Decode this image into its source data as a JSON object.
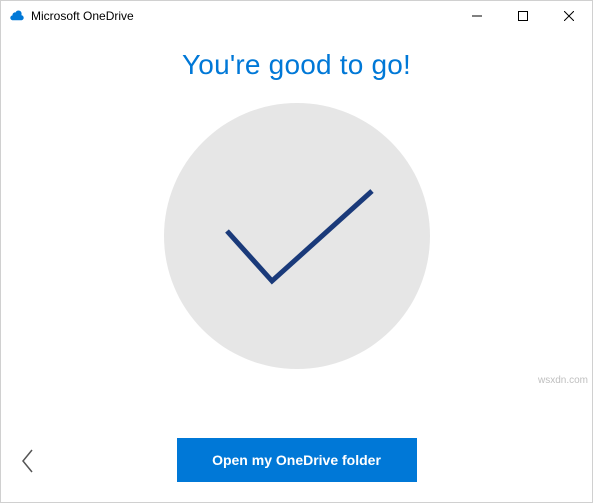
{
  "window": {
    "title": "Microsoft OneDrive"
  },
  "content": {
    "heading": "You're good to go!",
    "button_label": "Open my OneDrive folder"
  },
  "watermark": "wsxdn.com",
  "colors": {
    "accent": "#0078d7",
    "circle_bg": "#e6e6e6",
    "check_stroke": "#1a3a7a"
  }
}
